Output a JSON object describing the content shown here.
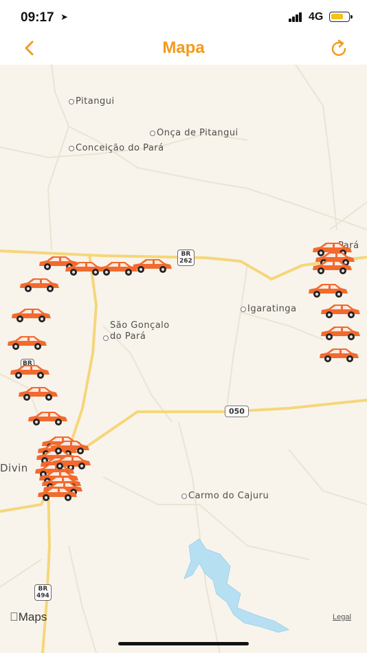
{
  "status_bar": {
    "time": "09:17",
    "network": "4G"
  },
  "nav": {
    "title": "Mapa"
  },
  "map": {
    "places": [
      "Pitangui",
      "Onça de Pitangui",
      "Conceição do Pará",
      "Igaratinga",
      "São Gonçalo\ndo Pará",
      "Carmo do Cajuru",
      "Pará",
      "Divin"
    ],
    "highway_shields": [
      {
        "line1": "BR",
        "line2": "262"
      },
      {
        "line1": "BR",
        "line2": "494"
      },
      {
        "line1": "BR",
        "line2": ""
      }
    ],
    "route_label": "050",
    "attribution": "Maps",
    "legal": "Legal",
    "car_marker_color": "#f26a2e"
  }
}
